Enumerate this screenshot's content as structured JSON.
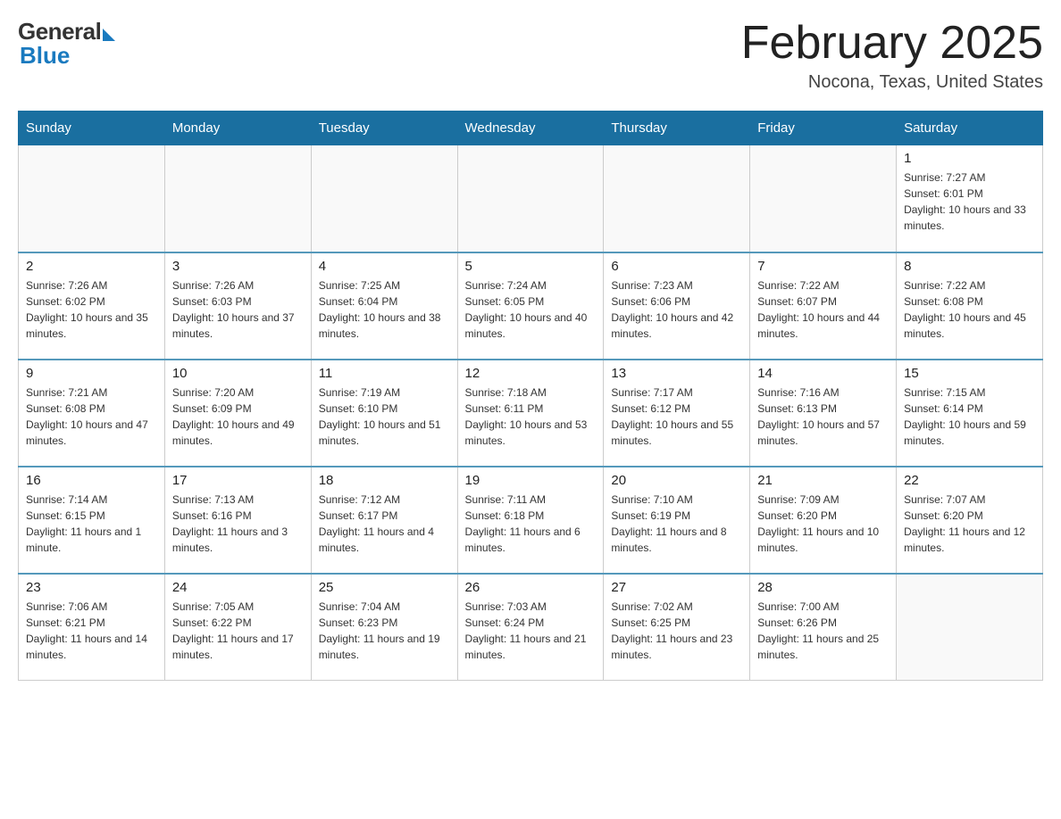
{
  "logo": {
    "general": "General",
    "blue": "Blue"
  },
  "title": {
    "month_year": "February 2025",
    "location": "Nocona, Texas, United States"
  },
  "days_of_week": [
    "Sunday",
    "Monday",
    "Tuesday",
    "Wednesday",
    "Thursday",
    "Friday",
    "Saturday"
  ],
  "weeks": [
    [
      {
        "day": "",
        "info": ""
      },
      {
        "day": "",
        "info": ""
      },
      {
        "day": "",
        "info": ""
      },
      {
        "day": "",
        "info": ""
      },
      {
        "day": "",
        "info": ""
      },
      {
        "day": "",
        "info": ""
      },
      {
        "day": "1",
        "info": "Sunrise: 7:27 AM\nSunset: 6:01 PM\nDaylight: 10 hours and 33 minutes."
      }
    ],
    [
      {
        "day": "2",
        "info": "Sunrise: 7:26 AM\nSunset: 6:02 PM\nDaylight: 10 hours and 35 minutes."
      },
      {
        "day": "3",
        "info": "Sunrise: 7:26 AM\nSunset: 6:03 PM\nDaylight: 10 hours and 37 minutes."
      },
      {
        "day": "4",
        "info": "Sunrise: 7:25 AM\nSunset: 6:04 PM\nDaylight: 10 hours and 38 minutes."
      },
      {
        "day": "5",
        "info": "Sunrise: 7:24 AM\nSunset: 6:05 PM\nDaylight: 10 hours and 40 minutes."
      },
      {
        "day": "6",
        "info": "Sunrise: 7:23 AM\nSunset: 6:06 PM\nDaylight: 10 hours and 42 minutes."
      },
      {
        "day": "7",
        "info": "Sunrise: 7:22 AM\nSunset: 6:07 PM\nDaylight: 10 hours and 44 minutes."
      },
      {
        "day": "8",
        "info": "Sunrise: 7:22 AM\nSunset: 6:08 PM\nDaylight: 10 hours and 45 minutes."
      }
    ],
    [
      {
        "day": "9",
        "info": "Sunrise: 7:21 AM\nSunset: 6:08 PM\nDaylight: 10 hours and 47 minutes."
      },
      {
        "day": "10",
        "info": "Sunrise: 7:20 AM\nSunset: 6:09 PM\nDaylight: 10 hours and 49 minutes."
      },
      {
        "day": "11",
        "info": "Sunrise: 7:19 AM\nSunset: 6:10 PM\nDaylight: 10 hours and 51 minutes."
      },
      {
        "day": "12",
        "info": "Sunrise: 7:18 AM\nSunset: 6:11 PM\nDaylight: 10 hours and 53 minutes."
      },
      {
        "day": "13",
        "info": "Sunrise: 7:17 AM\nSunset: 6:12 PM\nDaylight: 10 hours and 55 minutes."
      },
      {
        "day": "14",
        "info": "Sunrise: 7:16 AM\nSunset: 6:13 PM\nDaylight: 10 hours and 57 minutes."
      },
      {
        "day": "15",
        "info": "Sunrise: 7:15 AM\nSunset: 6:14 PM\nDaylight: 10 hours and 59 minutes."
      }
    ],
    [
      {
        "day": "16",
        "info": "Sunrise: 7:14 AM\nSunset: 6:15 PM\nDaylight: 11 hours and 1 minute."
      },
      {
        "day": "17",
        "info": "Sunrise: 7:13 AM\nSunset: 6:16 PM\nDaylight: 11 hours and 3 minutes."
      },
      {
        "day": "18",
        "info": "Sunrise: 7:12 AM\nSunset: 6:17 PM\nDaylight: 11 hours and 4 minutes."
      },
      {
        "day": "19",
        "info": "Sunrise: 7:11 AM\nSunset: 6:18 PM\nDaylight: 11 hours and 6 minutes."
      },
      {
        "day": "20",
        "info": "Sunrise: 7:10 AM\nSunset: 6:19 PM\nDaylight: 11 hours and 8 minutes."
      },
      {
        "day": "21",
        "info": "Sunrise: 7:09 AM\nSunset: 6:20 PM\nDaylight: 11 hours and 10 minutes."
      },
      {
        "day": "22",
        "info": "Sunrise: 7:07 AM\nSunset: 6:20 PM\nDaylight: 11 hours and 12 minutes."
      }
    ],
    [
      {
        "day": "23",
        "info": "Sunrise: 7:06 AM\nSunset: 6:21 PM\nDaylight: 11 hours and 14 minutes."
      },
      {
        "day": "24",
        "info": "Sunrise: 7:05 AM\nSunset: 6:22 PM\nDaylight: 11 hours and 17 minutes."
      },
      {
        "day": "25",
        "info": "Sunrise: 7:04 AM\nSunset: 6:23 PM\nDaylight: 11 hours and 19 minutes."
      },
      {
        "day": "26",
        "info": "Sunrise: 7:03 AM\nSunset: 6:24 PM\nDaylight: 11 hours and 21 minutes."
      },
      {
        "day": "27",
        "info": "Sunrise: 7:02 AM\nSunset: 6:25 PM\nDaylight: 11 hours and 23 minutes."
      },
      {
        "day": "28",
        "info": "Sunrise: 7:00 AM\nSunset: 6:26 PM\nDaylight: 11 hours and 25 minutes."
      },
      {
        "day": "",
        "info": ""
      }
    ]
  ]
}
